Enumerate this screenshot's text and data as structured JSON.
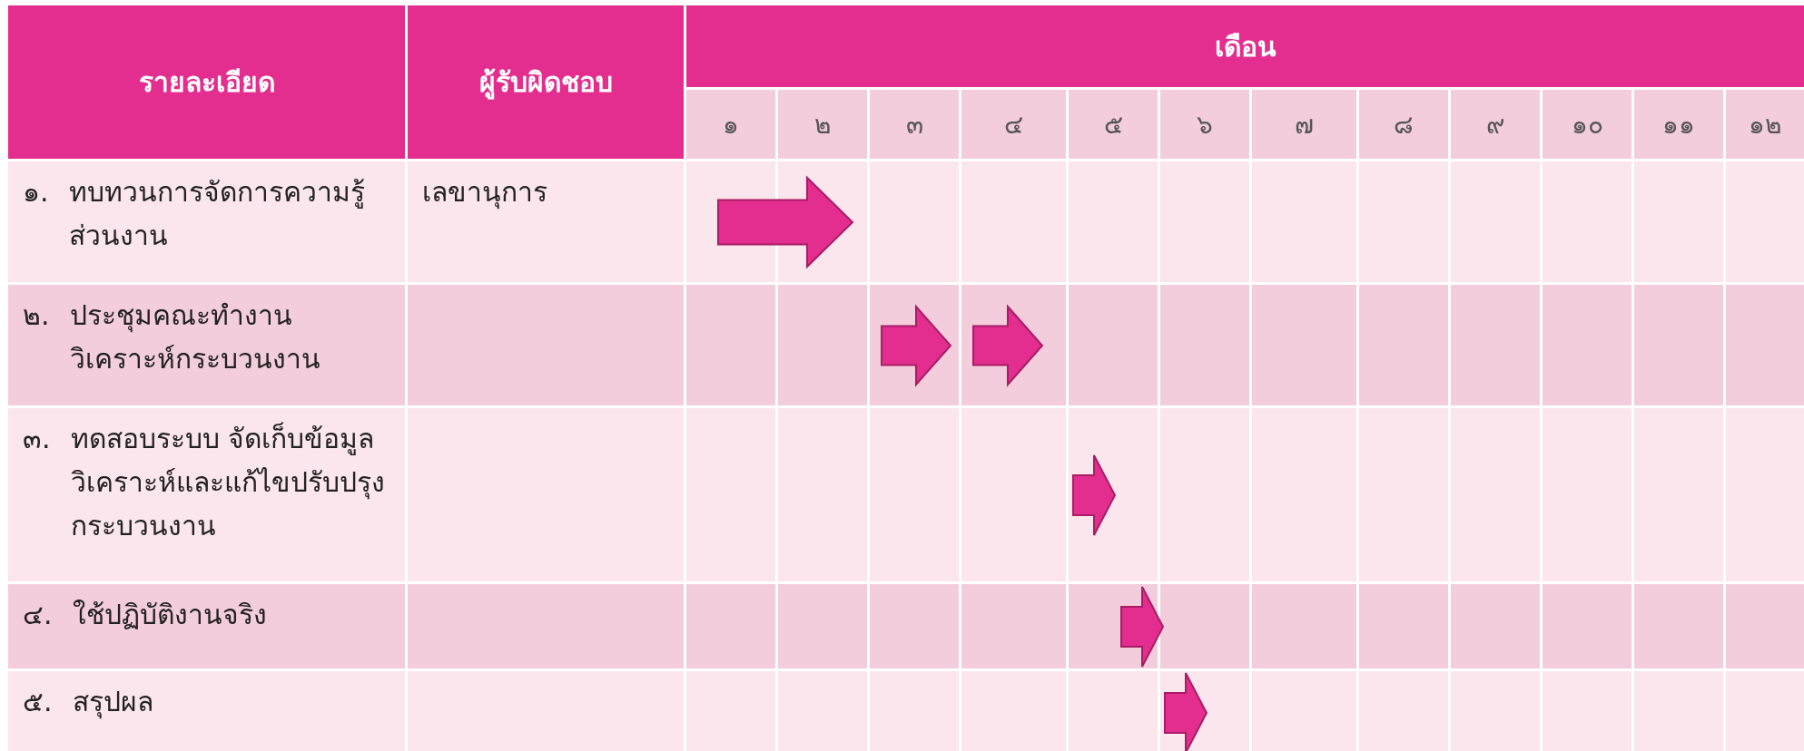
{
  "table": {
    "columns": [
      {
        "label": "รายละเอียด"
      },
      {
        "label": "ผู้รับผิดชอบ"
      }
    ],
    "month_group": "เดือน",
    "months": [
      "๑",
      "๒",
      "๓",
      "๔",
      "๕",
      "๖",
      "๗",
      "๘",
      "๙",
      "๑๐",
      "๑๑",
      "๑๒"
    ],
    "rows": [
      {
        "number": "๑.",
        "task": "ทบทวนการจัดการความรู้ส่วนงาน",
        "owner": "เลขานุการ",
        "timeline": [
          {
            "kind": "start"
          },
          {
            "kind": "end"
          },
          {
            "kind": "empty"
          },
          {
            "kind": "empty"
          },
          {
            "kind": "empty"
          },
          {
            "kind": "empty"
          },
          {
            "kind": "empty"
          },
          {
            "kind": "empty"
          },
          {
            "kind": "empty"
          },
          {
            "kind": "empty"
          },
          {
            "kind": "empty"
          },
          {
            "kind": "empty"
          }
        ]
      },
      {
        "number": "๒.",
        "task": "ประชุมคณะทำงาน วิเคราะห์กระบวนงาน",
        "timeline": [
          {
            "kind": "empty"
          },
          {
            "kind": "empty"
          },
          {
            "kind": "single"
          },
          {
            "kind": "single"
          },
          {
            "kind": "empty"
          },
          {
            "kind": "empty"
          },
          {
            "kind": "empty"
          },
          {
            "kind": "empty"
          },
          {
            "kind": "empty"
          },
          {
            "kind": "empty"
          },
          {
            "kind": "empty"
          },
          {
            "kind": "empty"
          }
        ]
      },
      {
        "number": "๓.",
        "task": "ทดสอบระบบ จัดเก็บข้อมูล วิเคราะห์และแก้ไขปรับปรุง กระบวนงาน",
        "timeline": [
          {
            "kind": "empty"
          },
          {
            "kind": "empty"
          },
          {
            "kind": "empty"
          },
          {
            "kind": "empty"
          },
          {
            "kind": "small"
          },
          {
            "kind": "empty"
          },
          {
            "kind": "empty"
          },
          {
            "kind": "empty"
          },
          {
            "kind": "empty"
          },
          {
            "kind": "empty"
          },
          {
            "kind": "empty"
          },
          {
            "kind": "empty"
          }
        ]
      },
      {
        "number": "๔.",
        "task": "ใช้ปฏิบัติงานจริง",
        "timeline": [
          {
            "kind": "empty"
          },
          {
            "kind": "empty"
          },
          {
            "kind": "empty"
          },
          {
            "kind": "empty"
          },
          {
            "kind": "edge"
          },
          {
            "kind": "empty"
          },
          {
            "kind": "empty"
          },
          {
            "kind": "empty"
          },
          {
            "kind": "empty"
          },
          {
            "kind": "empty"
          },
          {
            "kind": "empty"
          },
          {
            "kind": "empty"
          }
        ]
      },
      {
        "number": "๕.",
        "task": "สรุปผล",
        "timeline": [
          {
            "kind": "empty"
          },
          {
            "kind": "empty"
          },
          {
            "kind": "empty"
          },
          {
            "kind": "empty"
          },
          {
            "kind": "empty"
          },
          {
            "kind": "small"
          },
          {
            "kind": "empty"
          },
          {
            "kind": "empty"
          },
          {
            "kind": "empty"
          },
          {
            "kind": "empty"
          },
          {
            "kind": "empty"
          },
          {
            "kind": "empty"
          }
        ]
      }
    ]
  }
}
